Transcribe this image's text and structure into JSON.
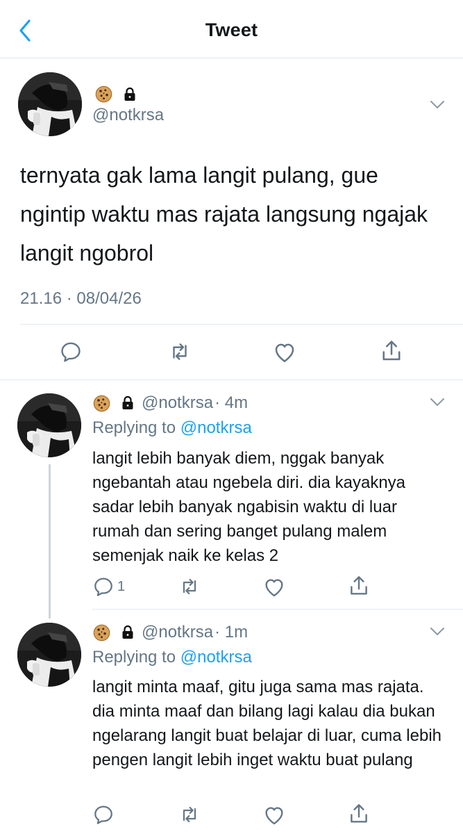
{
  "header": {
    "title": "Tweet",
    "back_icon": "chevron-left-icon"
  },
  "colors": {
    "accent": "#1da1f2",
    "muted": "#657786",
    "text": "#14171a",
    "divider": "#e1e8ed"
  },
  "main_tweet": {
    "emoji_icons": [
      "cookie-icon",
      "lock-icon"
    ],
    "handle": "@notkrsa",
    "text": "ternyata gak lama langit pulang, gue ngintip waktu mas rajata langsung ngajak langit ngobrol",
    "timestamp": "21.16 · 08/04/26"
  },
  "replies": [
    {
      "handle": "@notkrsa",
      "time": "· 4m",
      "replying_prefix": "Replying to ",
      "replying_to": "@notkrsa",
      "text": "langit lebih banyak diem, nggak banyak ngebantah atau ngebela diri. dia kayaknya sadar lebih banyak ngabisin waktu di luar rumah dan sering banget pulang malem semenjak naik ke kelas 2",
      "reply_count": "1"
    },
    {
      "handle": "@notkrsa",
      "time": "· 1m",
      "replying_prefix": "Replying to ",
      "replying_to": "@notkrsa",
      "text": "langit minta maaf, gitu juga sama mas rajata. dia minta maaf dan bilang lagi kalau dia bukan ngelarang langit buat belajar di luar, cuma lebih pengen langit lebih inget waktu buat pulang",
      "reply_count": ""
    }
  ],
  "actions": [
    "reply-icon",
    "retweet-icon",
    "like-icon",
    "share-icon"
  ]
}
